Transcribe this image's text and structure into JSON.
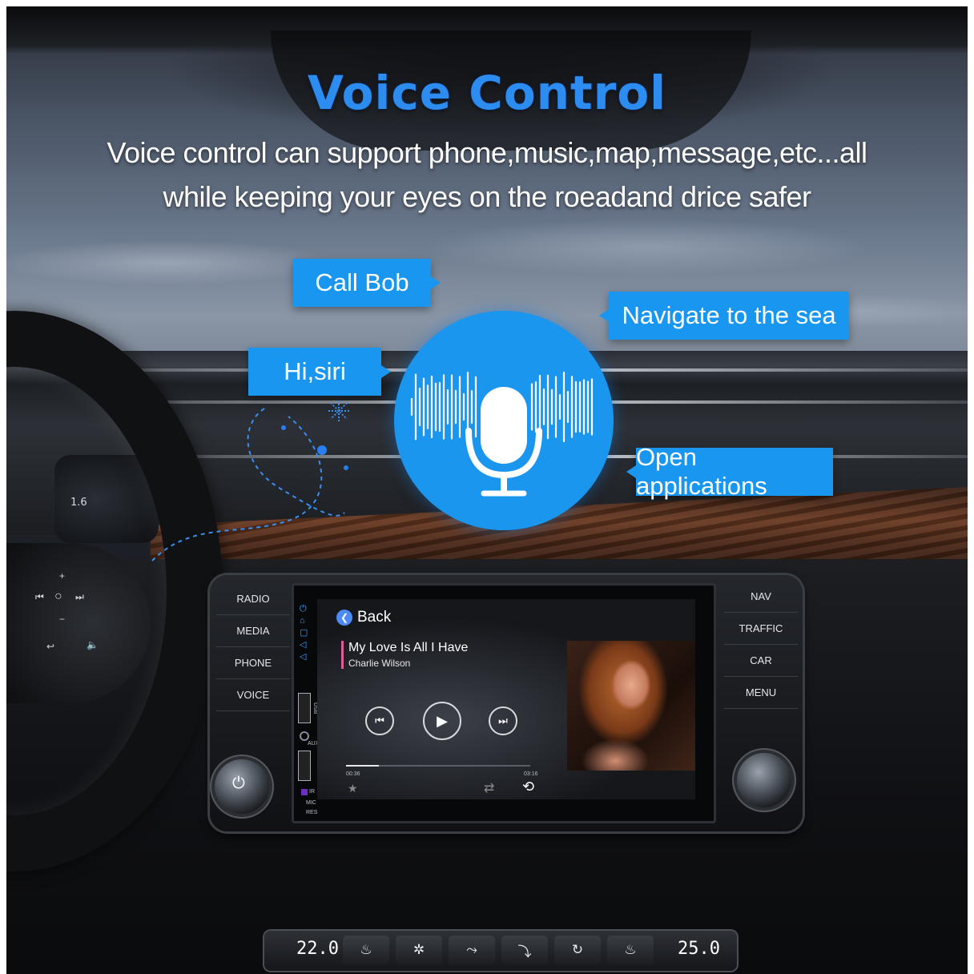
{
  "headline": {
    "title": "Voice Control",
    "subtitle_line1": "Voice control can support phone,music,map,message,etc...all",
    "subtitle_line2": "while keeping your eyes on the roeadand drice safer"
  },
  "voice_commands": {
    "call": "Call Bob",
    "wake": "Hi,siri",
    "navigate": "Navigate to the sea",
    "open": "Open applications"
  },
  "colors": {
    "accent_blue": "#1996f0",
    "title_blue": "#2c8cf0"
  },
  "head_unit": {
    "left_buttons": [
      "RADIO",
      "MEDIA",
      "PHONE",
      "VOICE"
    ],
    "right_buttons": [
      "NAV",
      "TRAFFIC",
      "CAR",
      "MENU"
    ],
    "side_labels": {
      "usb": "USB",
      "aux": "AUX",
      "ir": "IR",
      "mic": "MIC",
      "res": "RES"
    }
  },
  "player": {
    "back_label": "Back",
    "song_title": "My Love Is All I Have",
    "artist": "Charlie Wilson",
    "elapsed": "00:36",
    "duration": "03:16",
    "progress_fraction": 0.18,
    "icons": [
      "previous-icon",
      "play-icon",
      "next-icon",
      "star-icon",
      "shuffle-icon",
      "repeat-icon"
    ]
  },
  "instrument_cluster": {
    "readout": "1.6"
  },
  "climate": {
    "left_temp": "22.0",
    "right_temp": "25.0"
  }
}
